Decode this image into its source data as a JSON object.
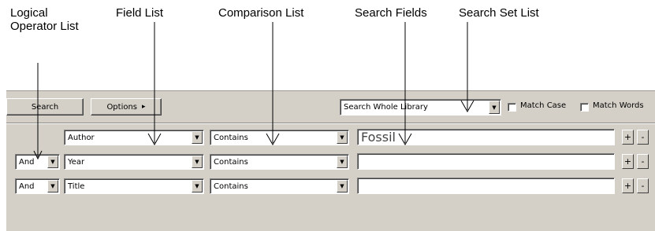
{
  "callouts": {
    "logical_line1": "Logical",
    "logical_line2": "Operator List",
    "field_list": "Field List",
    "comparison_list": "Comparison List",
    "search_fields": "Search Fields",
    "search_set_list": "Search Set List"
  },
  "toolbar": {
    "search_label": "Search",
    "options_label": "Options",
    "options_arrow": "▸",
    "search_set_value": "Search Whole Library",
    "match_case_label": "Match Case",
    "match_words_label": "Match Words",
    "match_case_checked": false,
    "match_words_checked": false
  },
  "rows": [
    {
      "operator": "",
      "field": "Author",
      "comparison": "Contains",
      "term": "Fossil"
    },
    {
      "operator": "And",
      "field": "Year",
      "comparison": "Contains",
      "term": ""
    },
    {
      "operator": "And",
      "field": "Title",
      "comparison": "Contains",
      "term": ""
    }
  ],
  "row_buttons": {
    "add": "+",
    "remove": "-"
  },
  "icons": {
    "dropdown": "down-triangle",
    "options": "right-triangle"
  },
  "colors": {
    "panel_bg": "#d4d0c8",
    "field_bg": "#ffffff"
  }
}
